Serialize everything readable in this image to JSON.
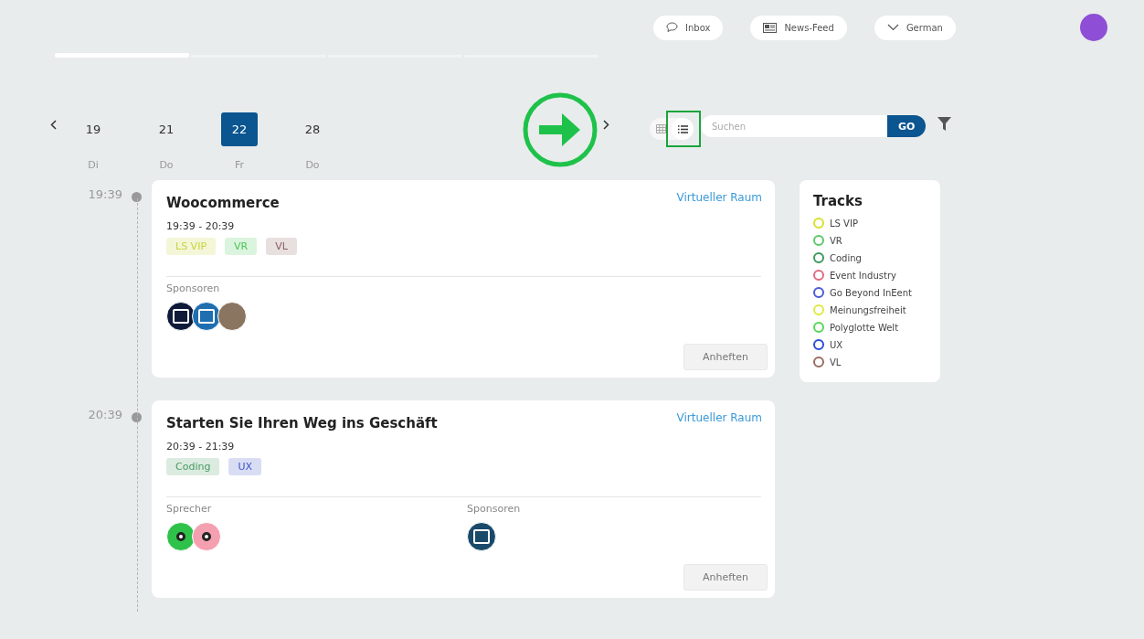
{
  "header": {
    "buttons": [
      {
        "kind": "chat",
        "label": "Inbox"
      },
      {
        "kind": "news",
        "label": "News-Feed"
      },
      {
        "kind": "dropdown",
        "label": "German"
      }
    ]
  },
  "tab_bar": [
    {
      "selected": true
    },
    {
      "selected": false
    },
    {
      "selected": false
    },
    {
      "selected": false
    }
  ],
  "dates": [
    {
      "day": "19",
      "weekday": "Di",
      "selected": false
    },
    {
      "day": "21",
      "weekday": "Do",
      "selected": false
    },
    {
      "day": "22",
      "weekday": "Fr",
      "selected": true
    },
    {
      "day": "28",
      "weekday": "Do",
      "selected": false
    }
  ],
  "view_toggle": [
    {
      "kind": "grid",
      "selected": false
    },
    {
      "kind": "list",
      "selected": true
    }
  ],
  "search": {
    "placeholder": "Suchen",
    "button": "GO"
  },
  "sessions": [
    {
      "time": "19:39",
      "title": "Woocommerce",
      "range": "19:39 - 20:39",
      "room": "Virtueller Raum",
      "tags": [
        {
          "label": "LS VIP",
          "color": "#c8d43a"
        },
        {
          "label": "VR",
          "color": "#4cc75a"
        },
        {
          "label": "VL",
          "color": "#8a6060"
        }
      ],
      "groups": [
        {
          "label": "Sponsoren",
          "avatars": [
            {
              "kind": "logo",
              "color": "#0e1a38"
            },
            {
              "kind": "logo",
              "color": "#1f6fb0"
            },
            {
              "kind": "photo",
              "color": "#8a7560"
            }
          ]
        }
      ],
      "action": "Anheften"
    },
    {
      "time": "20:39",
      "title": "Starten Sie Ihren Weg ins Geschäft",
      "range": "20:39 - 21:39",
      "room": "Virtueller Raum",
      "tags": [
        {
          "label": "Coding",
          "color": "#4a9a62"
        },
        {
          "label": "UX",
          "color": "#3f55c9"
        }
      ],
      "groups": [
        {
          "label": "Sprecher",
          "avatars": [
            {
              "kind": "monster",
              "color": "#2ec24a"
            },
            {
              "kind": "monster",
              "color": "#f4a0b0"
            }
          ]
        },
        {
          "label": "Sponsoren",
          "avatars": [
            {
              "kind": "logo",
              "color": "#1a4a6a"
            }
          ]
        }
      ],
      "action": "Anheften"
    }
  ],
  "tracks": {
    "title": "Tracks",
    "items": [
      {
        "label": "LS VIP",
        "color": "#d8e02a"
      },
      {
        "label": "VR",
        "color": "#5cc86a"
      },
      {
        "label": "Coding",
        "color": "#3a9a5a"
      },
      {
        "label": "Event Industry",
        "color": "#e06a80"
      },
      {
        "label": "Go Beyond InEent",
        "color": "#4a5ad8"
      },
      {
        "label": "Meinungsfreiheit",
        "color": "#e2e840"
      },
      {
        "label": "Polyglotte Welt",
        "color": "#55d855"
      },
      {
        "label": "UX",
        "color": "#2a4ad8"
      },
      {
        "label": "VL",
        "color": "#9a6a60"
      }
    ]
  }
}
